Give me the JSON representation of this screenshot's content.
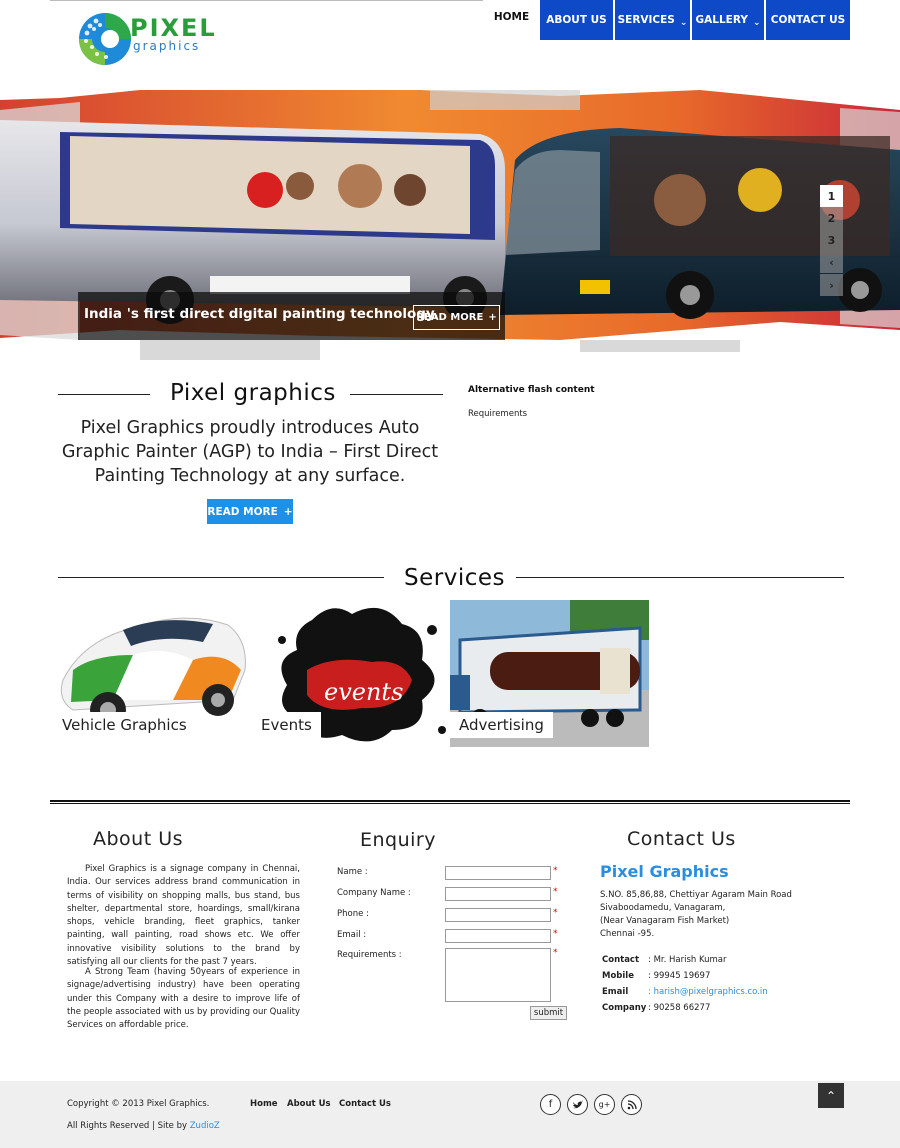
{
  "brand": {
    "logo_main": "PIXEL",
    "logo_sub": "graphics"
  },
  "nav": [
    {
      "label": "HOME",
      "caret": false
    },
    {
      "label": "ABOUT US",
      "caret": false
    },
    {
      "label": "SERVICES",
      "caret": true
    },
    {
      "label": "GALLERY",
      "caret": true
    },
    {
      "label": "CONTACT US",
      "caret": false
    }
  ],
  "slider": {
    "caption": "India 's first direct digital painting technology.",
    "button": "READ MORE",
    "pages": [
      "1",
      "2",
      "3"
    ],
    "active_page": "1"
  },
  "intro": {
    "title": "Pixel graphics",
    "text": "Pixel Graphics proudly introduces Auto Graphic Painter (AGP) to India – First Direct Painting Technology at any surface.",
    "button": "READ MORE",
    "flash_title": "Alternative flash content",
    "flash_requirements": "Requirements"
  },
  "services": {
    "title": "Services",
    "items": [
      {
        "label": "Vehicle Graphics",
        "image_text": ""
      },
      {
        "label": "Events",
        "image_text": "events"
      },
      {
        "label": "Advertising",
        "image_text": ""
      }
    ]
  },
  "about": {
    "title": "About Us",
    "p1": "Pixel Graphics is a signage company in Chennai, India. Our services address brand communication in terms of visibility on shopping malls, bus stand, bus shelter, departmental store, hoardings, small/kirana shops, vehicle branding, fleet graphics, tanker painting, wall painting, road shows etc. We offer innovative visibility solutions to the brand by satisfying all our clients for the past 7 years.",
    "p2": "A Strong Team (having 50years of experience in signage/advertising industry) have been operating under this Company with a desire to improve life of the people associated with us by providing our Quality Services on affordable price."
  },
  "enquiry": {
    "title": "Enquiry",
    "fields": [
      {
        "label": "Name :",
        "value": ""
      },
      {
        "label": "Company Name :",
        "value": ""
      },
      {
        "label": "Phone :",
        "value": ""
      },
      {
        "label": "Email :",
        "value": ""
      }
    ],
    "textarea_label": "Requirements :",
    "required_mark": "*",
    "submit": "submit"
  },
  "contact": {
    "title": "Contact Us",
    "company": "Pixel Graphics",
    "address": [
      "S.NO. 85,86,88, Chettiyar Agaram Main Road",
      "Sivaboodamedu, Vanagaram,",
      "(Near Vanagaram Fish Market)",
      "Chennai -95."
    ],
    "rows": [
      {
        "key": "Contact",
        "value": ": Mr. Harish Kumar"
      },
      {
        "key": "Mobile",
        "value": ": 99945 19697"
      },
      {
        "key": "Email",
        "value": ": harish@pixelgraphics.co.in"
      },
      {
        "key": "Company",
        "value": ": 90258 66277"
      }
    ]
  },
  "footer": {
    "copyright": "Copyright © 2013 Pixel Graphics.",
    "rights": "All Rights Reserved | Site by ",
    "site_by": "ZudioZ",
    "links": [
      "Home",
      "About Us",
      "Contact Us"
    ],
    "social": [
      "f",
      "t",
      "g+",
      "rss"
    ]
  },
  "colors": {
    "nav_blue": "#0e49c8",
    "button_blue": "#1e90e6",
    "link_blue": "#2a8ee0"
  }
}
